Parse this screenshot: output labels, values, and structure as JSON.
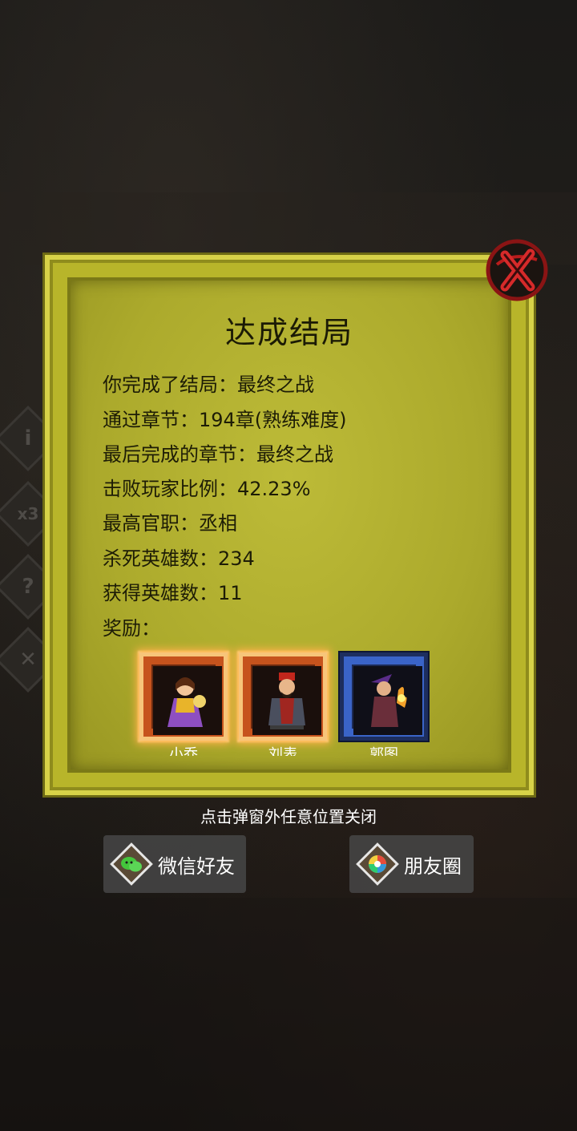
{
  "popup": {
    "title": "达成结局",
    "lines": [
      "你完成了结局：最终之战",
      "通过章节：194章(熟练难度)",
      "最后完成的章节：最终之战",
      "击败玩家比例：42.23%",
      "最高官职：丞相",
      "杀死英雄数：234",
      "获得英雄数：11",
      "奖励："
    ],
    "rewards": [
      {
        "name": "小乔",
        "frame": "orange"
      },
      {
        "name": "刘表",
        "frame": "orange"
      },
      {
        "name": "郭图",
        "frame": "blue"
      }
    ]
  },
  "hint": "点击弹窗外任意位置关闭",
  "share": {
    "wechat_label": "微信好友",
    "moments_label": "朋友圈"
  },
  "side_menu": [
    "i",
    "x3",
    "?",
    "✕"
  ],
  "colors": {
    "panel": "#b8b52a",
    "panel_border": "#d7d248",
    "close_red": "#b81c1c",
    "reward_orange": "#c6531d",
    "reward_blue": "#3a64c8"
  }
}
